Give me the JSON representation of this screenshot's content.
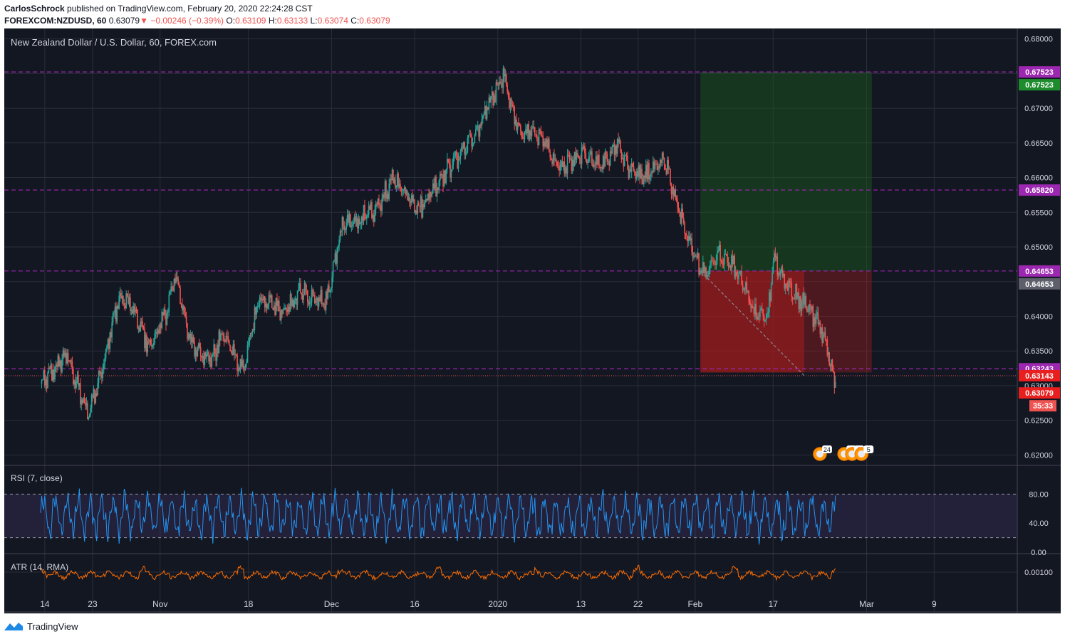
{
  "header": {
    "author": "CarlosSchrock",
    "published_text": "published on TradingView.com, February 20, 2020 22:24:28 CST",
    "symbol": "FOREXCOM:NZDUSD, 60",
    "last": "0.63079",
    "change": "−0.00246 (−0.39%)",
    "open_label": "O:",
    "open": "0.63109",
    "high_label": "H:",
    "high": "0.63133",
    "low_label": "L:",
    "low": "0.63074",
    "close_label": "C:",
    "close": "0.63079"
  },
  "chart_title": "New Zealand Dollar / U.S. Dollar, 60, FOREX.com",
  "footer": {
    "brand": "TradingView"
  },
  "colors": {
    "background": "#131722",
    "grid": "#2a2e39",
    "up": "#26a69a",
    "down": "#ef5350",
    "purple_line": "#9c27b0",
    "rsi": "#2196f3",
    "atr": "#ff6d00",
    "profit_zone": "#1b5e20",
    "loss_zone": "#b71c1c",
    "axis_text": "#d1d4dc"
  },
  "chart_data": [
    {
      "type": "candlestick",
      "title": "New Zealand Dollar / U.S. Dollar, 60, FOREX.com",
      "ylim": [
        0.6185,
        0.6815
      ],
      "y_ticks": [
        "0.68000",
        "0.67500",
        "0.67000",
        "0.66500",
        "0.66000",
        "0.65500",
        "0.65000",
        "0.64500",
        "0.64000",
        "0.63500",
        "0.63000",
        "0.62500",
        "0.62000"
      ],
      "x_ticks": [
        "14",
        "23",
        "Nov",
        "18",
        "Dec",
        "16",
        "2020",
        "13",
        "22",
        "Feb",
        "17",
        "Mar",
        "9"
      ],
      "x_tick_index": [
        0.8,
        10,
        23,
        40,
        56,
        72,
        88,
        104,
        115,
        126,
        141,
        159,
        172
      ],
      "x_range": [
        -7,
        188
      ],
      "price_path": [
        [
          0,
          0.63
        ],
        [
          5,
          0.6345
        ],
        [
          9,
          0.6258
        ],
        [
          11,
          0.6302
        ],
        [
          15,
          0.6425
        ],
        [
          17,
          0.642
        ],
        [
          21,
          0.6355
        ],
        [
          24,
          0.6402
        ],
        [
          26,
          0.6458
        ],
        [
          29,
          0.6358
        ],
        [
          33,
          0.6338
        ],
        [
          35,
          0.6375
        ],
        [
          39,
          0.6322
        ],
        [
          42,
          0.6425
        ],
        [
          47,
          0.6405
        ],
        [
          50,
          0.6435
        ],
        [
          55,
          0.642
        ],
        [
          58,
          0.653
        ],
        [
          64,
          0.6548
        ],
        [
          68,
          0.6598
        ],
        [
          73,
          0.6555
        ],
        [
          77,
          0.66
        ],
        [
          84,
          0.6665
        ],
        [
          89,
          0.675
        ],
        [
          92,
          0.6665
        ],
        [
          96,
          0.6665
        ],
        [
          100,
          0.6612
        ],
        [
          104,
          0.6635
        ],
        [
          108,
          0.6615
        ],
        [
          111,
          0.665
        ],
        [
          113,
          0.6615
        ],
        [
          116,
          0.6598
        ],
        [
          120,
          0.6625
        ],
        [
          123,
          0.6548
        ],
        [
          127,
          0.6465
        ],
        [
          128,
          0.6462
        ],
        [
          131,
          0.649
        ],
        [
          134,
          0.6465
        ],
        [
          137,
          0.641
        ],
        [
          140,
          0.64
        ],
        [
          141,
          0.6485
        ],
        [
          144,
          0.644
        ],
        [
          147,
          0.642
        ],
        [
          150,
          0.6388
        ],
        [
          153,
          0.6308
        ]
      ],
      "price_lines": [
        {
          "value": 0.67523,
          "label": "0.67523"
        },
        {
          "value": 0.6582,
          "label": "0.65820"
        },
        {
          "value": 0.64653,
          "label": "0.64653"
        },
        {
          "value": 0.63243,
          "label": "0.63243"
        }
      ],
      "axis_labels": [
        {
          "value": 0.67523,
          "text": "0.67523",
          "style": "purple"
        },
        {
          "value": 0.67523,
          "text": "0.67523",
          "style": "green",
          "offset": 1
        },
        {
          "value": 0.6582,
          "text": "0.65820",
          "style": "purple"
        },
        {
          "value": 0.64653,
          "text": "0.64653",
          "style": "purple"
        },
        {
          "value": 0.64653,
          "text": "0.64653",
          "style": "grey",
          "offset": 1
        },
        {
          "value": 0.63243,
          "text": "0.63243",
          "style": "purple"
        },
        {
          "value": 0.63143,
          "text": "0.63143",
          "style": "red"
        },
        {
          "value": 0.63079,
          "text": "0.63079",
          "style": "red",
          "offset": 1
        },
        {
          "value": 0.63079,
          "text": "35:33",
          "style": "red-small",
          "offset": 2
        }
      ],
      "current_price": 0.63143,
      "position": {
        "start_index": 127,
        "end_index": 160,
        "filled_to_index": 147,
        "target": 0.67523,
        "entry": 0.64653,
        "stop": 0.6319
      },
      "events": [
        {
          "index": 150,
          "label": "24"
        },
        {
          "index": 154.7,
          "label": "3"
        },
        {
          "index": 156.2,
          "label": "2"
        },
        {
          "index": 158.0,
          "label": "5"
        }
      ]
    },
    {
      "type": "line",
      "title": "RSI (7, close)",
      "ylim": [
        0,
        100
      ],
      "y_ticks": [
        "0.00",
        "40.00",
        "80.00"
      ],
      "bands": [
        20,
        80
      ]
    },
    {
      "type": "line",
      "title": "ATR (14, RMA)",
      "y_ticks": [
        "0.00100"
      ]
    }
  ]
}
